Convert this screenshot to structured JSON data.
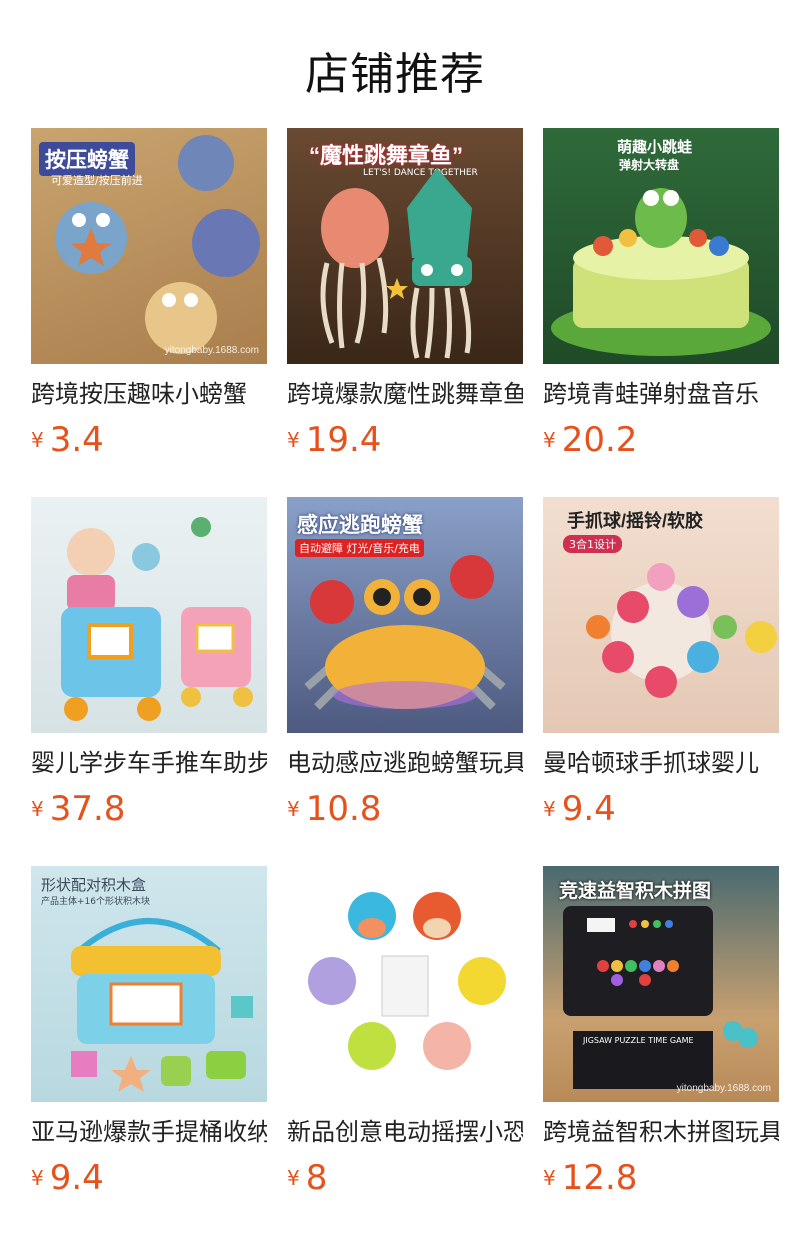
{
  "header": {
    "title": "店铺推荐"
  },
  "currency_symbol": "¥",
  "price_color": "#e5521c",
  "products": [
    {
      "name": "跨境按压趣味小螃蟹",
      "price": "3.4",
      "image_tag": "按压螃蟹",
      "image_sub": "可爱造型/按压前进",
      "watermark": "yitongbaby.1688.com"
    },
    {
      "name": "跨境爆款魔性跳舞章鱼",
      "price": "19.4",
      "image_tag": "“魔性跳舞章鱼”",
      "image_sub": "LET'S! DANCE TOGETHER"
    },
    {
      "name": "跨境青蛙弹射盘音乐",
      "price": "20.2",
      "image_tag": "萌趣小跳蛙",
      "image_sub": "弹射大转盘"
    },
    {
      "name": "婴儿学步车手推车助步",
      "price": "37.8"
    },
    {
      "name": "电动感应逃跑螃蟹玩具",
      "price": "10.8",
      "image_tag": "感应逃跑螃蟹",
      "image_sub": "自动避障  灯光/音乐/充电"
    },
    {
      "name": "曼哈顿球手抓球婴儿",
      "price": "9.4",
      "image_tag": "手抓球/摇铃/软胶",
      "image_sub": "3合1设计"
    },
    {
      "name": "亚马逊爆款手提桶收纳",
      "price": "9.4",
      "image_tag": "形状配对积木盒",
      "image_sub": "产品主体+16个形状积木块"
    },
    {
      "name": "新品创意电动摇摆小恐龙",
      "price": "8"
    },
    {
      "name": "跨境益智积木拼图玩具",
      "price": "12.8",
      "image_tag": "竞速益智积木拼图",
      "image_sub": "JIGSAW PUZZLE TIME GAME",
      "watermark": "yitongbaby.1688.com"
    }
  ]
}
